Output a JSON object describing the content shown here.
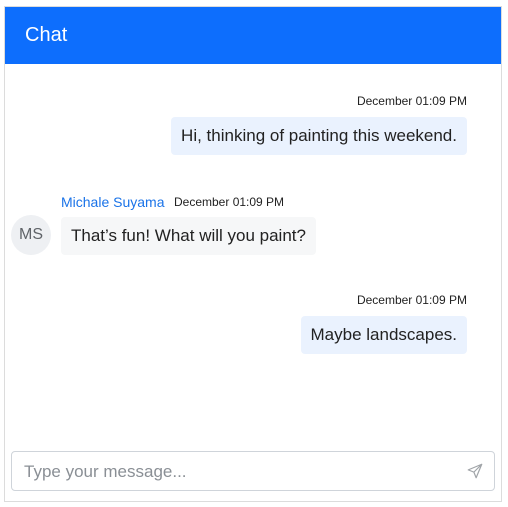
{
  "header": {
    "title": "Chat"
  },
  "messages": [
    {
      "time": "December 01:09 PM",
      "text": "Hi, thinking of painting this weekend."
    },
    {
      "author": "Michale Suyama",
      "initials": "MS",
      "time": "December 01:09 PM",
      "text": "That’s fun! What will you paint?"
    },
    {
      "time": "December 01:09 PM",
      "text": "Maybe landscapes."
    }
  ],
  "composer": {
    "placeholder": "Type your message...",
    "send_icon": "send-icon"
  }
}
